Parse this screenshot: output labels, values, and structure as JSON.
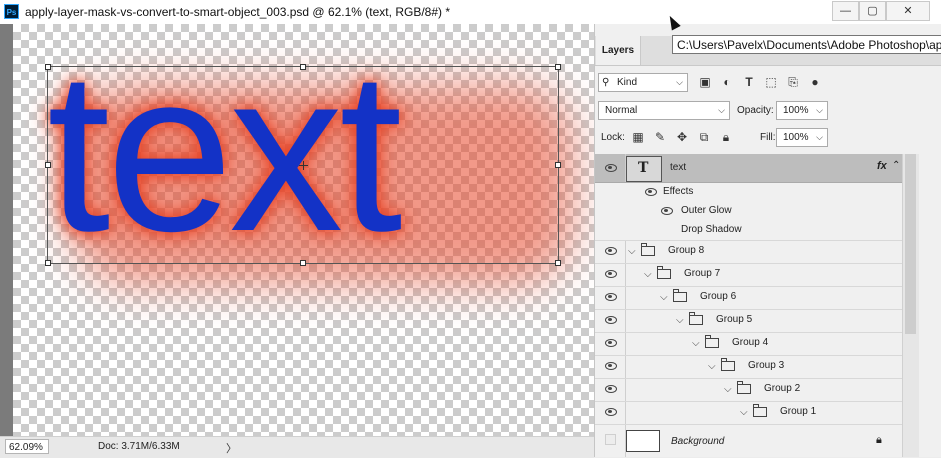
{
  "window": {
    "app_icon": "Ps",
    "title": "apply-layer-mask-vs-convert-to-smart-object_003.psd @ 62.1% (text, RGB/8#) *",
    "buttons": [
      "minimize-icon",
      "maximize-icon",
      "close-icon"
    ]
  },
  "canvas": {
    "text": "text",
    "text_color": "#1332c6",
    "glow_color": "#e84628"
  },
  "status": {
    "zoom": "62.09%",
    "doc_info": "Doc: 3.71M/6.33M",
    "arrow": "〉"
  },
  "tooltip": "C:\\Users\\Pavelx\\Documents\\Adobe Photoshop\\ap",
  "panel": {
    "tab": "Layers",
    "filter_kind": "Kind",
    "blend_mode": "Normal",
    "opacity_label": "Opacity:",
    "opacity_value": "100%",
    "lock_label": "Lock:",
    "fill_label": "Fill:",
    "fill_value": "100%",
    "layers": [
      {
        "name": "text",
        "type": "text",
        "selected": true,
        "fx": "fx"
      },
      {
        "name": "Effects",
        "type": "effects-header"
      },
      {
        "name": "Outer Glow",
        "type": "effect"
      },
      {
        "name": "Drop Shadow",
        "type": "effect"
      },
      {
        "name": "Group 8",
        "type": "group"
      },
      {
        "name": "Group 7",
        "type": "group"
      },
      {
        "name": "Group 6",
        "type": "group"
      },
      {
        "name": "Group 5",
        "type": "group"
      },
      {
        "name": "Group 4",
        "type": "group"
      },
      {
        "name": "Group 3",
        "type": "group"
      },
      {
        "name": "Group 2",
        "type": "group"
      },
      {
        "name": "Group 1",
        "type": "group"
      },
      {
        "name": "Background",
        "type": "background"
      }
    ]
  }
}
